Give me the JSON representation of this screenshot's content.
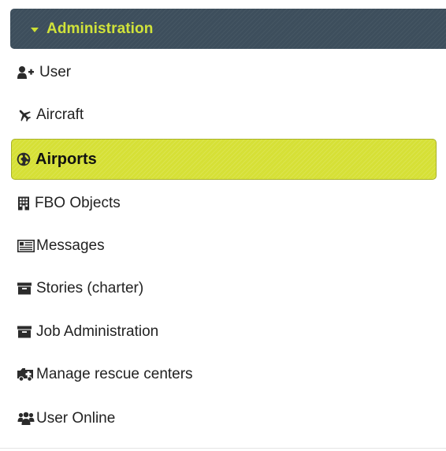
{
  "menu": {
    "section_title": "Administration",
    "items": [
      {
        "label": "User",
        "icon": "add-user-icon"
      },
      {
        "label": "Aircraft",
        "icon": "plane-icon"
      },
      {
        "label": "Airports",
        "icon": "globe-icon",
        "active": true
      },
      {
        "label": "FBO Objects",
        "icon": "building-icon"
      },
      {
        "label": "Messages",
        "icon": "newspaper-icon"
      },
      {
        "label": "Stories (charter)",
        "icon": "archive-box-icon"
      },
      {
        "label": "Job Administration",
        "icon": "archive-box-icon"
      },
      {
        "label": "Manage rescue centers",
        "icon": "ambulance-icon"
      },
      {
        "label": "User Online",
        "icon": "users-group-icon"
      }
    ]
  },
  "colors": {
    "header_bg": "#3d4e5c",
    "header_text": "#d1e33a",
    "active_bg": "#d6e036"
  }
}
